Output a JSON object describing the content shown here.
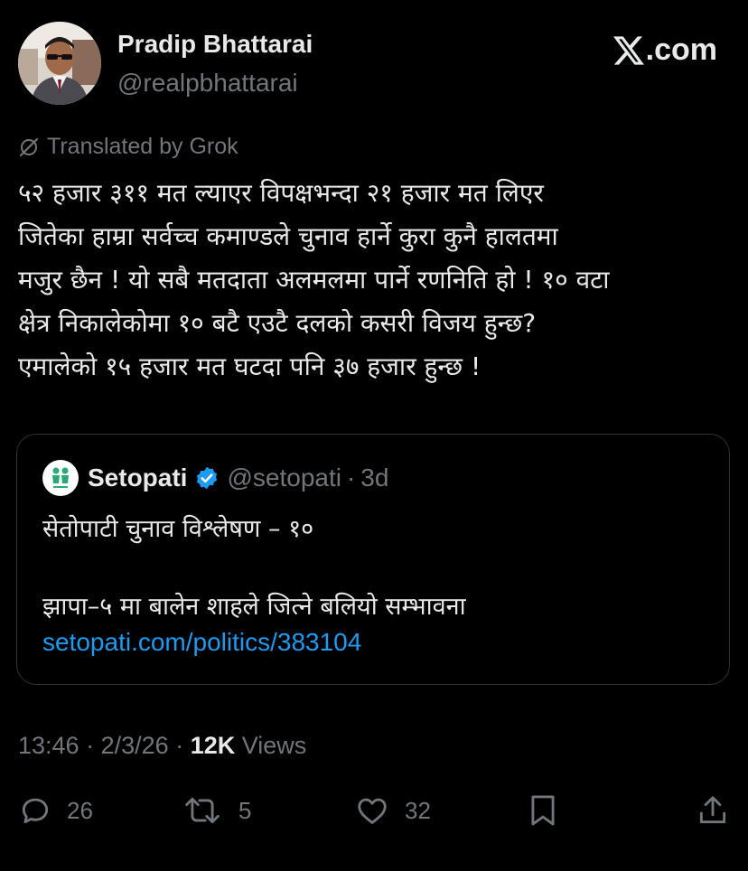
{
  "author": {
    "name": "Pradip Bhattarai",
    "handle": "@realpbhattarai"
  },
  "brand": {
    "suffix": ".com",
    "icon": "x-logo-icon"
  },
  "translation": {
    "label": "Translated by Grok",
    "icon": "grok-icon"
  },
  "tweet": {
    "lines": [
      "५२ हजार ३११ मत ल्याएर  विपक्षभन्दा २१ हजार मत लिएर",
      "जितेका हाम्रा सर्वच्च कमाण्डले चुनाव हार्ने कुरा कुनै हालतमा",
      "मजुर छैन ! यो सबै मतदाता अलमलमा पार्ने रणनिति हो !  १० वटा",
      "क्षेत्र निकालेकोमा १० बटै एउटै दलको कसरी विजय हुन्छ?",
      "एमालेको १५ हजार मत घटदा पनि ३७ हजार हुन्छ !"
    ]
  },
  "quote": {
    "name": "Setopati",
    "handle": "@setopati",
    "separator": "·",
    "time": "3d",
    "line1": "सेतोपाटी चुनाव विश्लेषण – १०",
    "line2": "झापा–५ मा बालेन शाहले जित्ने बलियो सम्भावना",
    "link": "setopati.com/politics/383104",
    "verified_color": "#1d9bf0"
  },
  "meta": {
    "time": "13:46",
    "sep1": "·",
    "date": "2/3/26",
    "sep2": "·",
    "views_count": "12K",
    "views_label": "Views"
  },
  "actions": {
    "replies": "26",
    "reposts": "5",
    "likes": "32"
  },
  "colors": {
    "background": "#000000",
    "text": "#e7e9ea",
    "muted": "#71767b",
    "link": "#1d9bf0",
    "border": "#2f3336"
  }
}
